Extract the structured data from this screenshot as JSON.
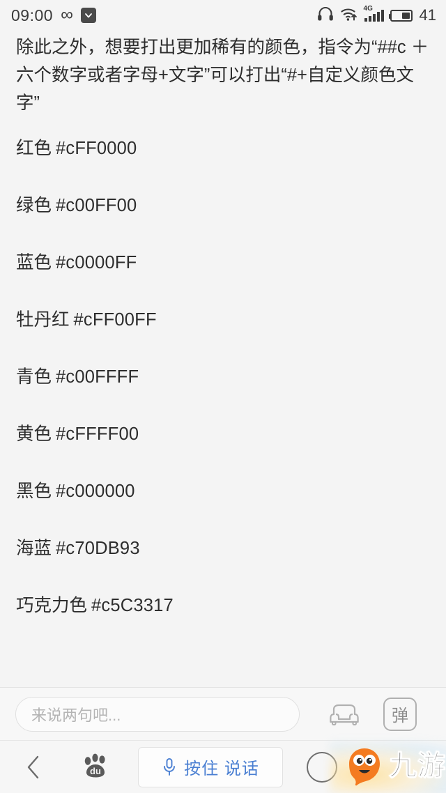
{
  "status_bar": {
    "clock": "09:00",
    "infinity_icon": "infinity-icon",
    "download_icon": "download-badge-icon",
    "headphone_icon": "headphone-icon",
    "wifi_icon": "wifi-upload-icon",
    "network_label": "4G",
    "signal_icon": "signal-bars-icon",
    "battery_icon": "battery-icon",
    "battery_level": "41"
  },
  "article": {
    "intro_paragraph": "除此之外，想要打出更加稀有的颜色，指令为“##c ＋ 六个数字或者字母+文字”可以打出“#+自定义颜色文字”",
    "color_entries": [
      {
        "name": "红色",
        "code": "#cFF0000"
      },
      {
        "name": "绿色",
        "code": "#c00FF00"
      },
      {
        "name": "蓝色",
        "code": "#c0000FF"
      },
      {
        "name": "牡丹红",
        "code": "#cFF00FF"
      },
      {
        "name": "青色",
        "code": "#c00FFFF"
      },
      {
        "name": "黄色",
        "code": "#cFFFF00"
      },
      {
        "name": "黑色",
        "code": "#c000000"
      },
      {
        "name": "海蓝",
        "code": "#c70DB93"
      },
      {
        "name": "巧克力色",
        "code": "#c5C3317"
      }
    ]
  },
  "comment_bar": {
    "input_placeholder": "来说两句吧...",
    "input_value": "",
    "sofa_icon": "sofa-icon",
    "danmaku_label": "弹"
  },
  "nav_bar": {
    "back_icon": "chevron-left-icon",
    "baidu_logo": "baidu-paw-logo",
    "speak_button_label": "按住 说话",
    "mic_icon": "microphone-icon",
    "circle_icon": "circle-icon"
  },
  "watermark": {
    "brand_text": "九游",
    "mascot_icon": "jiuyou-mascot-icon",
    "mascot_color": "#F47B20"
  },
  "colors": {
    "page_background": "#f4f4f4",
    "text": "#2d2d2d",
    "placeholder": "#b4b4b4",
    "accent_blue": "#4a7fd2",
    "border": "#e0e0e0"
  }
}
